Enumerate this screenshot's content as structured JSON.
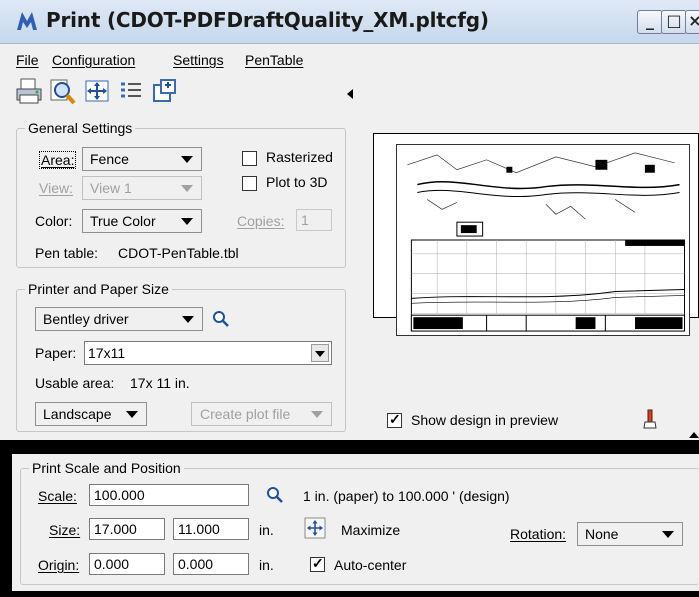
{
  "window": {
    "title": "Print  (CDOT-PDFDraftQuality_XM.pltcfg)",
    "minimize": "_",
    "maximize": "□",
    "close": "×"
  },
  "menu": [
    "File",
    "Configuration",
    "Settings",
    "PenTable"
  ],
  "toolbar_icons": [
    "printer-icon",
    "preview-magnifier-icon",
    "maximize-area-icon",
    "list-icon",
    "copy-window-icon"
  ],
  "general": {
    "title": "General Settings",
    "area_label": "Area:",
    "area_value": "Fence",
    "view_label": "View:",
    "view_value": "View 1",
    "color_label": "Color:",
    "color_value": "True Color",
    "rasterized": "Rasterized",
    "plot3d": "Plot to 3D",
    "copies_label": "Copies:",
    "copies_value": "1",
    "pentable_label": "Pen table:",
    "pentable_value": "CDOT-PenTable.tbl"
  },
  "printer": {
    "title": "Printer and Paper Size",
    "driver": "Bentley driver",
    "paper_label": "Paper:",
    "paper_value": "17x11",
    "usable_label": "Usable area:",
    "usable_value": "17x 11 in.",
    "orientation": "Landscape",
    "create_plot": "Create plot file"
  },
  "preview": {
    "show_design": "Show design in preview",
    "show_design_checked": true
  },
  "scale": {
    "title": "Print Scale and Position",
    "scale_label": "Scale:",
    "scale_value": "100.000",
    "scale_desc": "1 in. (paper) to 100.000 ' (design)",
    "size_label": "Size:",
    "size_w": "17.000",
    "size_h": "11.000",
    "unit": "in.",
    "maximize": "Maximize",
    "rotation_label": "Rotation:",
    "rotation_value": "None",
    "origin_label": "Origin:",
    "origin_x": "0.000",
    "origin_y": "0.000",
    "autocenter": "Auto-center",
    "autocenter_checked": true
  }
}
